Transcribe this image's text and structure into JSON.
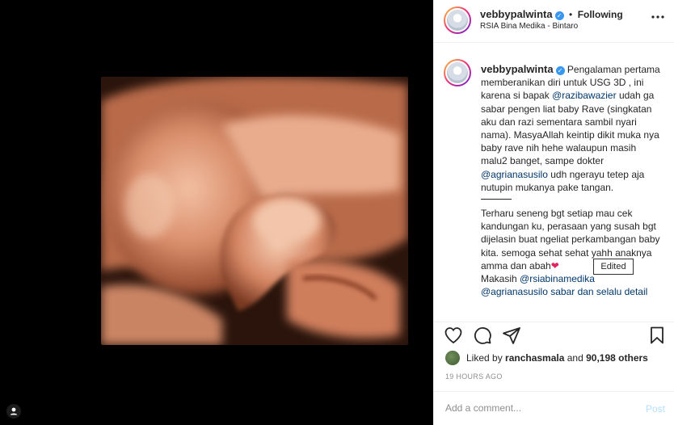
{
  "media": {
    "tag_icon": "user-tag-icon"
  },
  "header": {
    "username": "vebbypalwinta",
    "separator": "•",
    "follow_status": "Following",
    "location": "RSIA Bina Medika - Bintaro",
    "more_icon": "more-horizontal-icon"
  },
  "caption": {
    "username": "vebbypalwinta",
    "text_part1": "Pengalaman pertama memberanikan diri untuk USG 3D , ini karena si bapak ",
    "mention1": "@razibawazier",
    "text_part2": " udah ga sabar pengen liat baby Rave (singkatan aku dan razi sementara sambil nyari nama). MasyaAllah keintip dikit muka nya baby rave nih hehe walaupun masih malu2 banget, sampe dokter ",
    "mention2": "@agrianasusilo",
    "text_part3": " udh ngerayu tetep aja nutupin mukanya pake tangan.",
    "paragraph2": "Terharu seneng bgt setiap mau cek kandungan ku, perasaan yang susah bgt dijelasin buat ngeliat perkambangan baby kita. semoga sehat sehat yahh anaknya amma dan abah",
    "heart": "❤",
    "thanks": "Makasih ",
    "mention3": "@rsiabinamedika",
    "overflow_line": "@agrianasusilo sabar dan selalu detail"
  },
  "tooltip": "Edited",
  "actions": {
    "like_icon": "heart-icon",
    "comment_icon": "comment-icon",
    "share_icon": "share-icon",
    "save_icon": "bookmark-icon"
  },
  "likes": {
    "prefix": "Liked by ",
    "liker": "ranchasmala",
    "middle": " and ",
    "count": "90,198 others"
  },
  "timestamp": "19 hours ago",
  "comment": {
    "placeholder": "Add a comment...",
    "post_label": "Post"
  },
  "colors": {
    "verified": "#3897f0",
    "link": "#00376b",
    "post_disabled": "#b2dffc",
    "muted": "#8e8e8e"
  }
}
